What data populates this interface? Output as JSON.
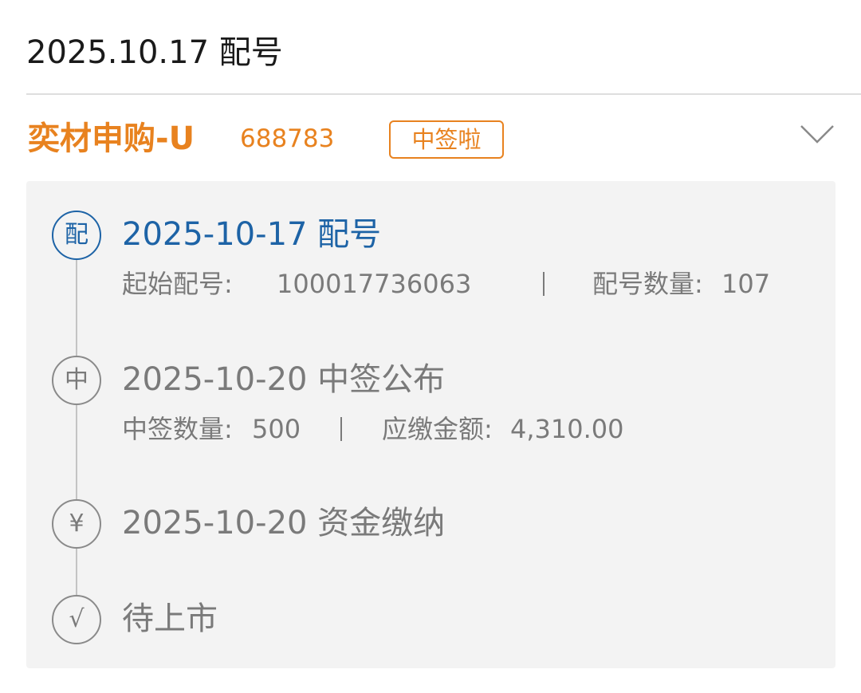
{
  "header": {
    "title": "2025.10.17 配号"
  },
  "stock": {
    "name": "奕材申购-U",
    "code": "688783",
    "badge": "中签啦",
    "expand_icon": "chevron-down-icon",
    "accent_color": "#e8821f"
  },
  "timeline": {
    "active_color": "#1d63a6",
    "inactive_color": "#7a7a7a",
    "steps": [
      {
        "icon_text": "配",
        "title": "2025-10-17 配号",
        "details": [
          {
            "label": "起始配号:",
            "value": "100017736063"
          },
          {
            "label": "配号数量:",
            "value": "107"
          }
        ]
      },
      {
        "icon_text": "中",
        "title": "2025-10-20 中签公布",
        "details": [
          {
            "label": "中签数量:",
            "value": "500"
          },
          {
            "label": "应缴金额:",
            "value": "4,310.00"
          }
        ]
      },
      {
        "icon_text": "¥",
        "title": "2025-10-20 资金缴纳"
      },
      {
        "icon_text": "√",
        "title": "待上市"
      }
    ]
  }
}
